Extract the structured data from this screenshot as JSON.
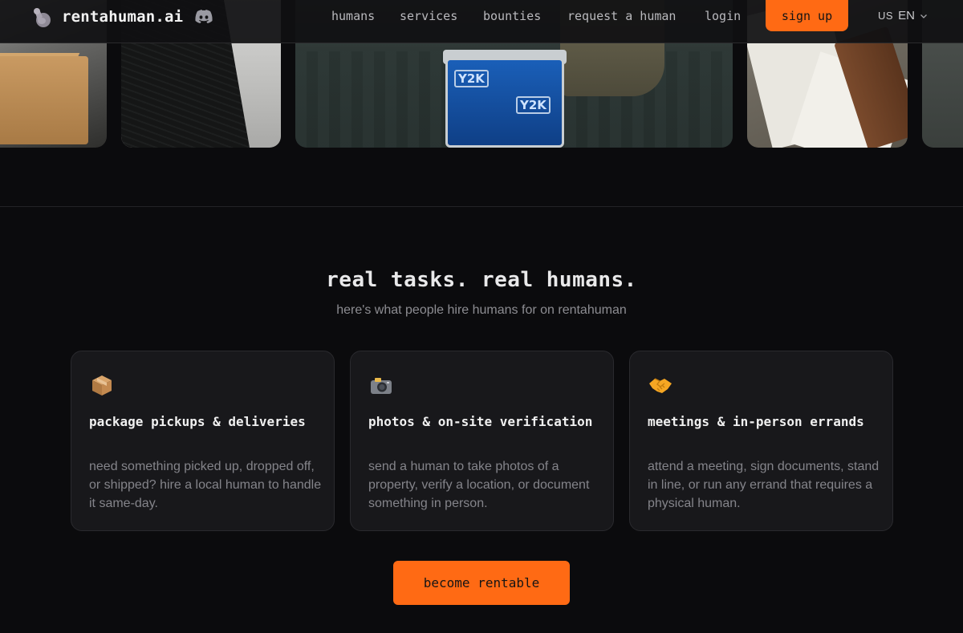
{
  "nav": {
    "brand": "rentahuman.ai",
    "logo_icon": "flexed-arm-icon",
    "discord_icon": "discord-icon",
    "links": [
      "humans",
      "services",
      "bounties",
      "request a human",
      "login"
    ],
    "signup_label": "sign up",
    "language": {
      "flag": "US",
      "code": "EN"
    }
  },
  "gallery": {
    "y2k_label": "Y2K"
  },
  "section": {
    "title": "real tasks. real humans.",
    "subtitle": "here's what people hire humans for on rentahuman",
    "cards": [
      {
        "icon": "package-icon",
        "title": "package pickups & deliveries",
        "text": "need something picked up, dropped off, or shipped? hire a local human to handle it same-day."
      },
      {
        "icon": "camera-icon",
        "title": "photos & on-site verification",
        "text": "send a human to take photos of a property, verify a location, or document something in person."
      },
      {
        "icon": "handshake-icon",
        "title": "meetings & in-person errands",
        "text": "attend a meeting, sign documents, stand in line, or run any errand that requires a physical human."
      }
    ],
    "cta_label": "become rentable"
  },
  "colors": {
    "accent": "#ff6a14",
    "background": "#0b0b0d",
    "card": "#18181b"
  }
}
